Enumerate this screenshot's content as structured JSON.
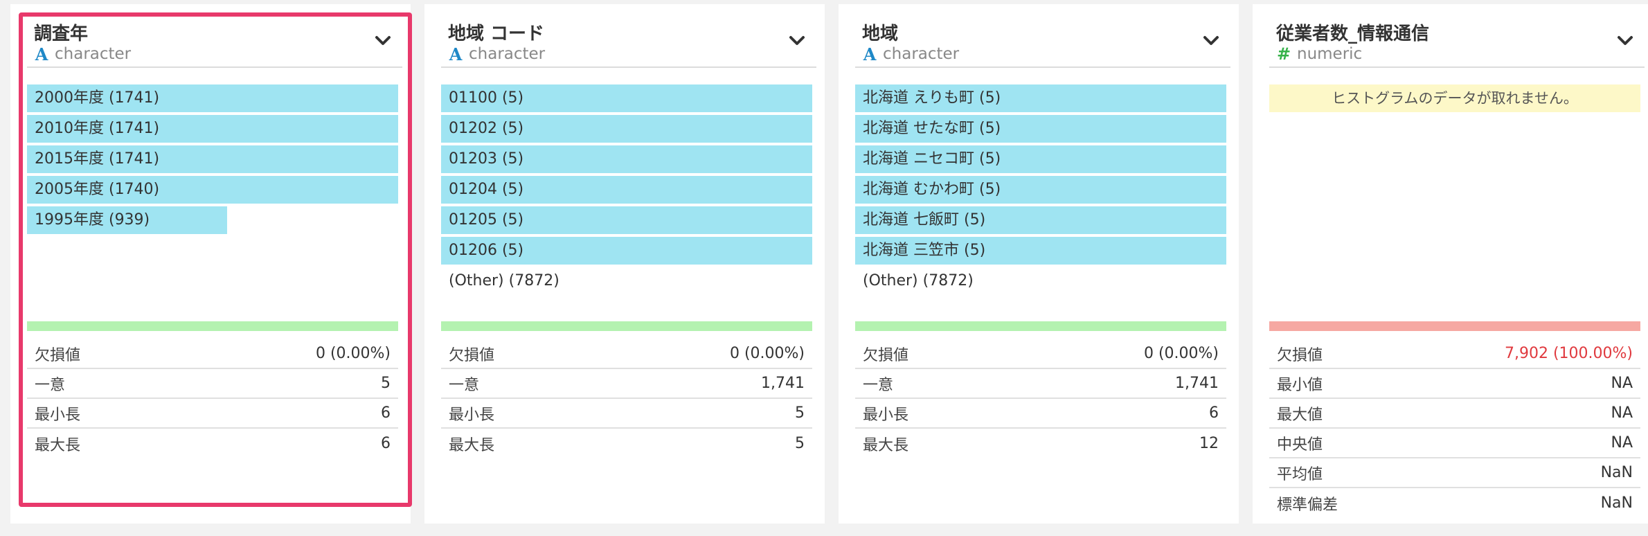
{
  "colors": {
    "bar": "#9fe4f2",
    "quality_ok": "#b4f2b0",
    "quality_bad": "#f6a8a2",
    "selection": "#e8396b",
    "alert": "#e0393e",
    "character_icon": "#1e88c7",
    "numeric_icon": "#36b24a"
  },
  "columns": [
    {
      "title": "調査年",
      "type_icon": "A",
      "type_label": "character",
      "selected": true,
      "bars": [
        {
          "label": "2000年度 (1741)",
          "fraction": 1.0
        },
        {
          "label": "2010年度 (1741)",
          "fraction": 1.0
        },
        {
          "label": "2015年度 (1741)",
          "fraction": 1.0
        },
        {
          "label": "2005年度 (1740)",
          "fraction": 1.0
        },
        {
          "label": "1995年度 (939)",
          "fraction": 0.539
        }
      ],
      "other": "",
      "quality": "ok",
      "stats": [
        {
          "label": "欠損値",
          "value": "0 (0.00%)"
        },
        {
          "label": "一意",
          "value": "5"
        },
        {
          "label": "最小長",
          "value": "6"
        },
        {
          "label": "最大長",
          "value": "6"
        }
      ]
    },
    {
      "title": "地域 コード",
      "type_icon": "A",
      "type_label": "character",
      "selected": false,
      "bars": [
        {
          "label": "01100 (5)",
          "fraction": 1.0
        },
        {
          "label": "01202 (5)",
          "fraction": 1.0
        },
        {
          "label": "01203 (5)",
          "fraction": 1.0
        },
        {
          "label": "01204 (5)",
          "fraction": 1.0
        },
        {
          "label": "01205 (5)",
          "fraction": 1.0
        },
        {
          "label": "01206 (5)",
          "fraction": 1.0
        }
      ],
      "other": "(Other) (7872)",
      "quality": "ok",
      "stats": [
        {
          "label": "欠損値",
          "value": "0 (0.00%)"
        },
        {
          "label": "一意",
          "value": "1,741"
        },
        {
          "label": "最小長",
          "value": "5"
        },
        {
          "label": "最大長",
          "value": "5"
        }
      ]
    },
    {
      "title": "地域",
      "type_icon": "A",
      "type_label": "character",
      "selected": false,
      "bars": [
        {
          "label": "北海道 えりも町 (5)",
          "fraction": 1.0
        },
        {
          "label": "北海道 せたな町 (5)",
          "fraction": 1.0
        },
        {
          "label": "北海道 ニセコ町 (5)",
          "fraction": 1.0
        },
        {
          "label": "北海道 むかわ町 (5)",
          "fraction": 1.0
        },
        {
          "label": "北海道 七飯町 (5)",
          "fraction": 1.0
        },
        {
          "label": "北海道 三笠市 (5)",
          "fraction": 1.0
        }
      ],
      "other": "(Other) (7872)",
      "quality": "ok",
      "stats": [
        {
          "label": "欠損値",
          "value": "0 (0.00%)"
        },
        {
          "label": "一意",
          "value": "1,741"
        },
        {
          "label": "最小長",
          "value": "6"
        },
        {
          "label": "最大長",
          "value": "12"
        }
      ]
    },
    {
      "title": "従業者数_情報通信",
      "type_icon": "#",
      "type_label": "numeric",
      "selected": false,
      "notice": "ヒストグラムのデータが取れません。",
      "bars": [],
      "other": "",
      "quality": "bad",
      "stats": [
        {
          "label": "欠損値",
          "value": "7,902 (100.00%)",
          "alert": true
        },
        {
          "label": "最小値",
          "value": "NA"
        },
        {
          "label": "最大値",
          "value": "NA"
        },
        {
          "label": "中央値",
          "value": "NA"
        },
        {
          "label": "平均値",
          "value": "NaN"
        },
        {
          "label": "標準偏差",
          "value": "NaN"
        }
      ]
    }
  ]
}
